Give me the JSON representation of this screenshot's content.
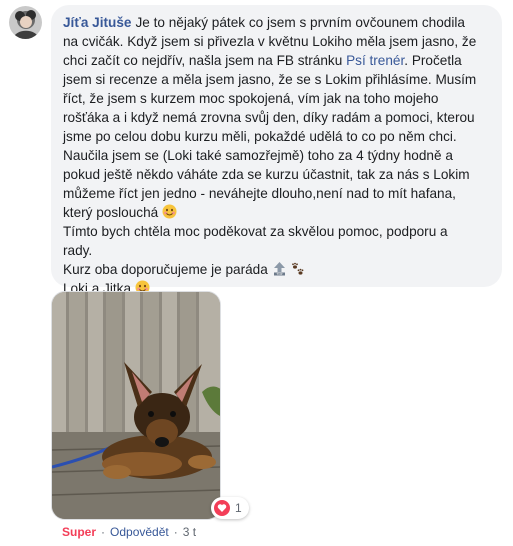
{
  "comment": {
    "author": "Jíťa Jituše",
    "lines": [
      "Je to nějaký pátek co jsem s prvním ovčounem chodila",
      "na cvičák. Když jsem si přivezla v květnu Lokiho měla jsem jasno, že",
      "chci začít co nejdřív, našla jsem na FB stránku",
      "jsem si recenze a měla jsem jasno, že se s Lokim přihlásíme. Musím",
      "říct, že jsem s kurzem moc spokojená, vím jak na toho mojeho",
      "rošťáka a i když nemá zrovna svůj den, díky radám a pomoci, kterou",
      "jsme po celou dobu kurzu měli, pokaždé udělá to co po něm chci.",
      "Naučila jsem se (Loki také samozřejmě) toho za 4 týdny hodně a",
      "pokud ještě někdo váháte zda se kurzu účastnit, tak za nás s Lokim",
      "můžeme říct jen jedno - neváhejte dlouho,není nad to mít hafana,",
      "který poslouchá",
      "Tímto bych chtěla moc poděkovat za skvělou pomoc, podporu a",
      "rady.",
      "Kurz oba doporučujeme je paráda",
      "Loki a Jitka"
    ],
    "link_text": "Psí trenér",
    "after_link": ". Pročetla",
    "emoji_names": [
      "smiling-face-icon",
      "top-arrow-icon",
      "paw-prints-icon"
    ]
  },
  "reactions": {
    "count": "1",
    "icon": "heart-reaction-icon"
  },
  "actions": {
    "reaction_label": "Super",
    "reply_label": "Odpovědět",
    "time": "3 t",
    "separator": "·"
  },
  "colors": {
    "link": "#385898",
    "bubble": "#f2f3f5",
    "love": "#f33e58",
    "meta": "#606770"
  }
}
